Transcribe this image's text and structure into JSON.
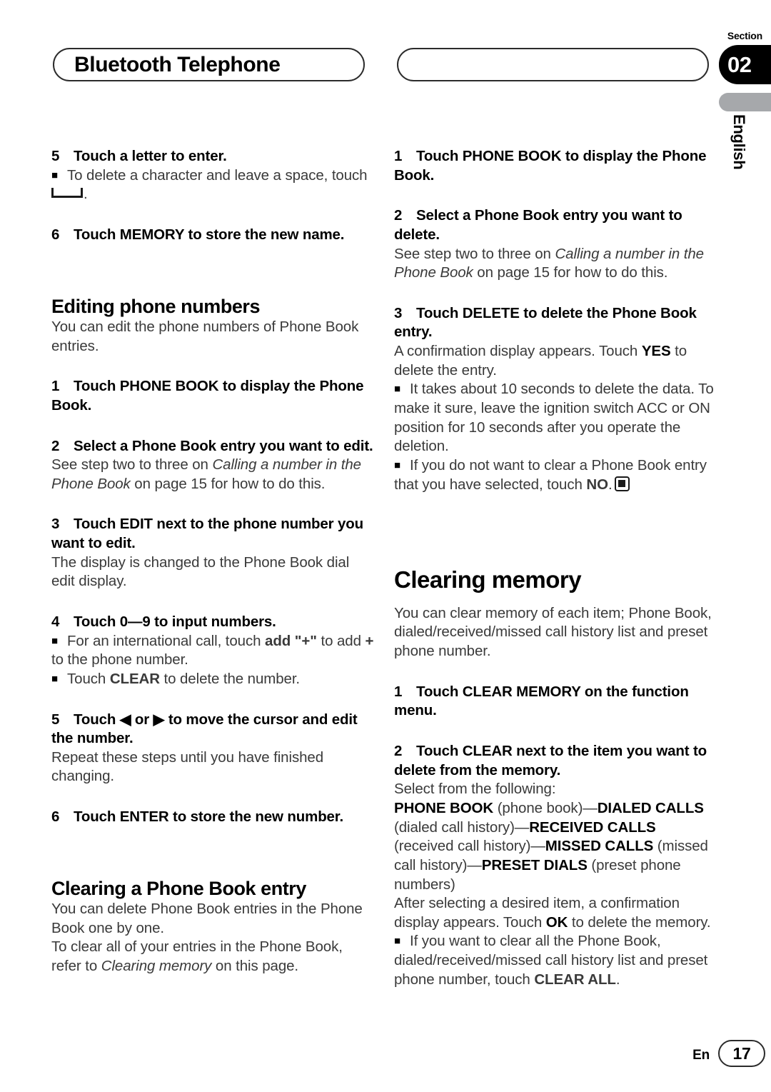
{
  "header": {
    "chapter_title": "Bluetooth Telephone",
    "section_label": "Section",
    "section_number": "02",
    "language_tab": "English"
  },
  "footer": {
    "language_code": "En",
    "page_number": "17"
  },
  "left_column": {
    "step5_enter": {
      "num": "5",
      "text": "Touch a letter to enter."
    },
    "bullet_delete_char": {
      "before": "To delete a character and leave a space, touch",
      "after": "."
    },
    "step6_memory": {
      "num": "6",
      "text": "Touch MEMORY to store the new name."
    },
    "heading_editing": "Editing phone numbers",
    "intro_editing": "You can edit the phone numbers of Phone Book entries.",
    "step1_phonebook": {
      "num": "1",
      "text": "Touch PHONE BOOK to display the Phone Book."
    },
    "step2_select": {
      "num": "2",
      "text": "Select a Phone Book entry you want to edit."
    },
    "step2_note": {
      "a": "See step two to three on ",
      "italic1": "Calling a number in the Phone Book",
      "b": " on page 15 for how to do this."
    },
    "step3_edit": {
      "num": "3",
      "text": "Touch EDIT next to the phone number you want to edit."
    },
    "step3_note": "The display is changed to the Phone Book dial edit display.",
    "step4_input": {
      "num": "4",
      "text": "Touch 0—9 to input numbers."
    },
    "bullet_international": {
      "a": "For an international call, touch ",
      "bold1": "add \"+\"",
      "b": " to add ",
      "bold2": "+",
      "c": " to the phone number."
    },
    "bullet_clear": {
      "a": "Touch ",
      "bold1": "CLEAR",
      "b": " to delete the number."
    },
    "step5_cursor": {
      "num": "5",
      "text": "Touch ◀ or ▶ to move the cursor and edit the number."
    },
    "step5_note": "Repeat these steps until you have finished changing.",
    "step6_enter": {
      "num": "6",
      "text": "Touch ENTER to store the new number."
    },
    "heading_clearing_entry": "Clearing a Phone Book entry",
    "clearing_entry_p1": "You can delete Phone Book entries in the Phone Book one by one.",
    "clearing_entry_p2": {
      "a": "To clear all of your entries in the Phone Book, refer to ",
      "italic1": "Clearing memory",
      "b": " on this page."
    }
  },
  "right_column": {
    "step1_phonebook": {
      "num": "1",
      "text": "Touch PHONE BOOK to display the Phone Book."
    },
    "step2_select": {
      "num": "2",
      "text": "Select a Phone Book entry you want to delete."
    },
    "step2_note": {
      "a": "See step two to three on ",
      "italic1": "Calling a number in the Phone Book",
      "b": " on page 15 for how to do this."
    },
    "step3_delete": {
      "num": "3",
      "text": "Touch DELETE to delete the Phone Book entry."
    },
    "step3_note": {
      "a": "A confirmation display appears. Touch ",
      "bold1": "YES",
      "b": " to delete the entry."
    },
    "bullet_10seconds": "It takes about 10 seconds to delete the data. To make it sure, leave the ignition switch ACC or ON position for 10 seconds after you operate the deletion.",
    "bullet_no": {
      "a": "If you do not want to clear a Phone Book entry that you have selected, touch ",
      "bold1": "NO",
      "b": "."
    },
    "heading_clearing_memory": "Clearing memory",
    "intro_clearing_memory": "You can clear memory of each item; Phone Book, dialed/received/missed call history list and preset phone number.",
    "step1_clear_memory": {
      "num": "1",
      "text": "Touch CLEAR MEMORY on the function menu."
    },
    "step2_clear_item": {
      "num": "2",
      "text": "Touch CLEAR next to the item you want to delete from the memory."
    },
    "select_following": "Select from the following:",
    "options_list": [
      {
        "bold": "PHONE BOOK",
        "plain": " (phone book)—"
      },
      {
        "bold": "DIALED CALLS",
        "plain": " (dialed call history)—"
      },
      {
        "bold": "RECEIVED CALLS",
        "plain": " (received call history)—"
      },
      {
        "bold": "MISSED CALLS",
        "plain": " (missed call history)—"
      },
      {
        "bold": "PRESET DIALS",
        "plain": " (preset phone numbers)"
      }
    ],
    "after_select": {
      "a": "After selecting a desired item, a confirmation display appears. Touch ",
      "bold1": "OK",
      "b": " to delete the memory."
    },
    "bullet_clear_all": {
      "a": "If you want to clear all the  Phone Book, dialed/received/missed call history list and preset phone number, touch ",
      "bold1": "CLEAR ALL",
      "b": "."
    }
  },
  "colors": {
    "accent_black": "#000000",
    "body_grey": "#3a3a3a",
    "tab_grey": "#a6a8ab"
  }
}
